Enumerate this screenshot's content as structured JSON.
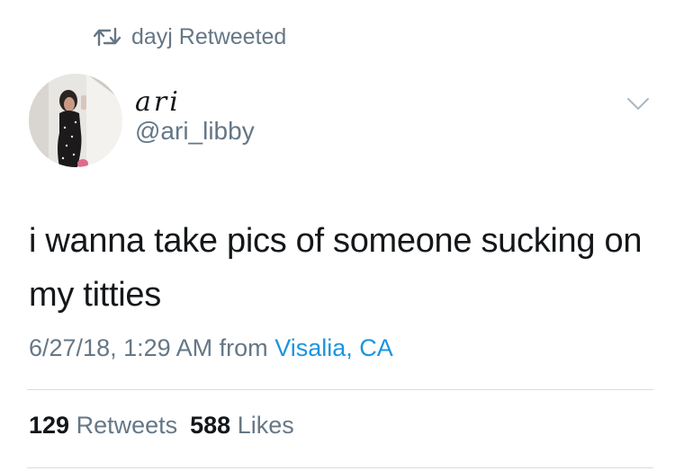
{
  "retweet": {
    "icon": "retweet-icon",
    "text": "dayj Retweeted"
  },
  "author": {
    "display_name": "ari",
    "handle": "@ari_libby",
    "avatar_icon": "profile-photo"
  },
  "tweet": {
    "text": "i wanna take pics of someone sucking on my titties",
    "date": "6/27/18, 1:29 AM",
    "from_label": "from",
    "location": "Visalia, CA"
  },
  "stats": {
    "retweets_count": "129",
    "retweets_label": "Retweets",
    "likes_count": "588",
    "likes_label": "Likes"
  },
  "colors": {
    "text": "#14171a",
    "secondary": "#657786",
    "link": "#1b95e0",
    "divider": "#d8dde1"
  }
}
